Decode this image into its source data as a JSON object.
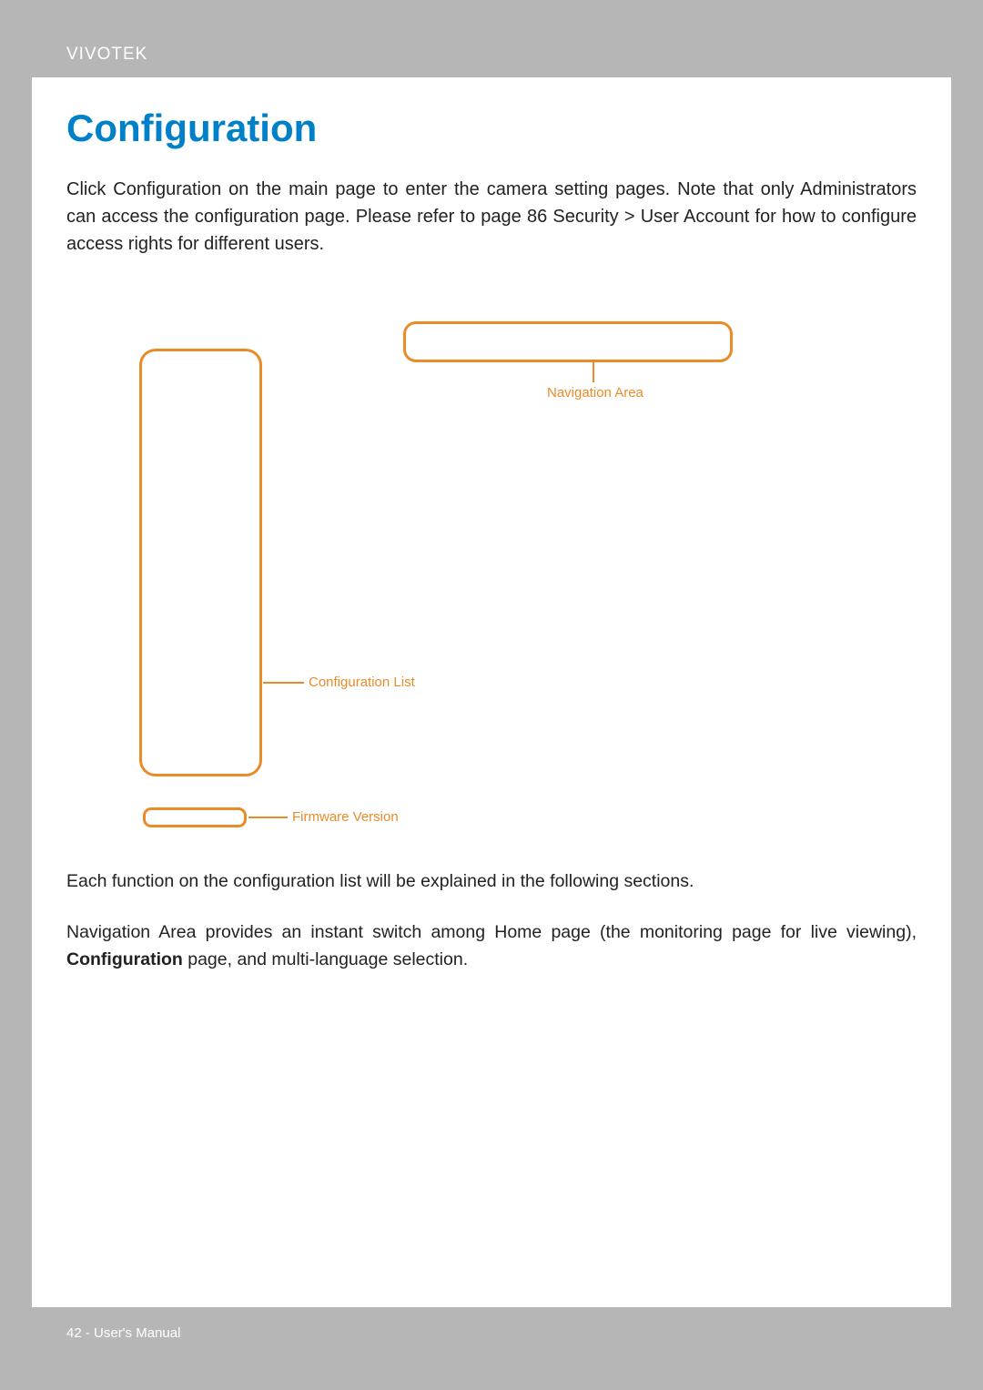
{
  "header": {
    "brand": "VIVOTEK"
  },
  "title": "Configuration",
  "intro": "Click Configuration on the main page to enter the camera setting pages. Note that only Administrators can access the configuration page. Please refer to page 86 Security > User Account for how to configure access rights for different users.",
  "diagram": {
    "config_list_label": "Configuration List",
    "navigation_area_label": "Navigation Area",
    "firmware_version_label": "Firmware Version"
  },
  "body1": "Each function on the configuration list will be explained in the following sections.",
  "body2_part1": "Navigation Area provides an instant switch among Home page (the monitoring page for live viewing), ",
  "body2_bold": "Configuration",
  "body2_part2": " page, and multi-language selection.",
  "footer": {
    "page_text": "42 - User's Manual"
  }
}
